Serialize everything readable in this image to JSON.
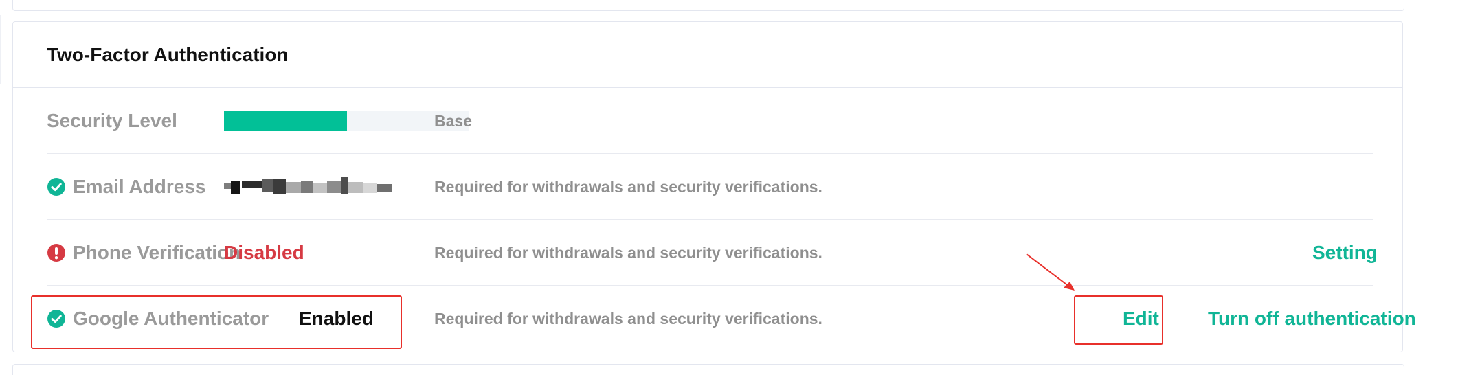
{
  "section": {
    "title": "Two-Factor Authentication"
  },
  "rows": [
    {
      "label": "Security Level",
      "icon": "none",
      "progress": 0.5,
      "value": "",
      "description": "Base"
    },
    {
      "label": "Email Address",
      "icon": "check-circle-icon",
      "value": "le*****@gmail.com",
      "value_redacted": true,
      "description": "Required for withdrawals and security verifications."
    },
    {
      "label": "Phone Verification",
      "icon": "exclamation-circle-icon",
      "value": "Disabled",
      "description": "Required for withdrawals and security verifications.",
      "action": "Setting"
    },
    {
      "label": "Google Authenticator",
      "icon": "check-circle-icon",
      "value": "Enabled",
      "description": "Required for withdrawals and security verifications.",
      "actions": [
        "Edit",
        "Turn off authentication"
      ]
    }
  ],
  "colors": {
    "accent": "#10b596",
    "progress_fill": "#02c097",
    "success_icon": "#10b596",
    "danger": "#d63a43",
    "annotation": "#e8302b"
  }
}
